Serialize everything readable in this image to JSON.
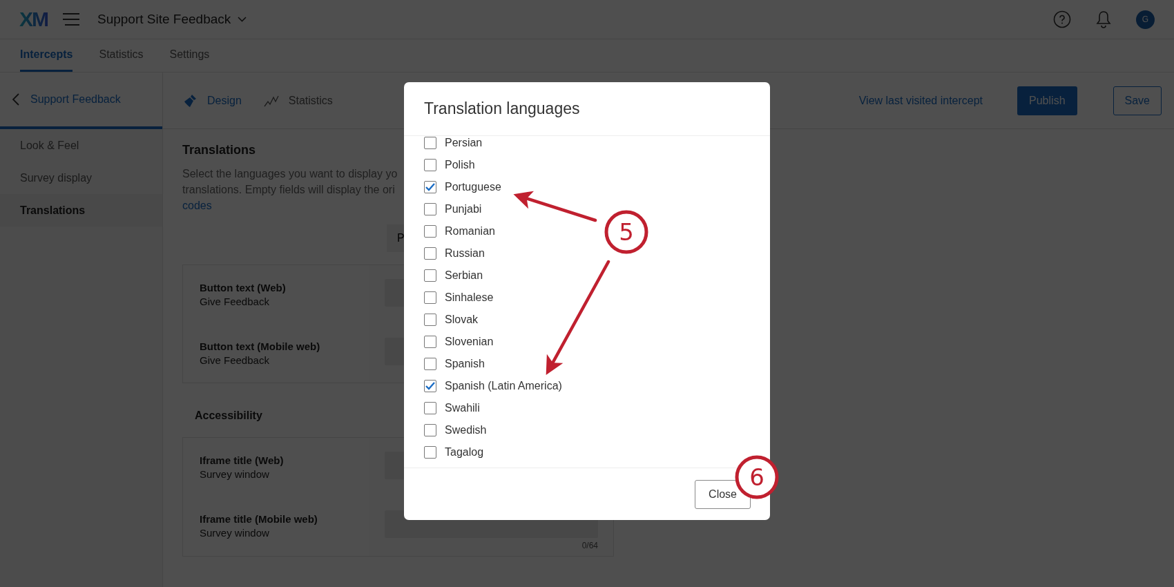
{
  "header": {
    "logo": "XM",
    "project_title": "Support Site Feedback",
    "avatar": "G"
  },
  "nav_tabs": [
    {
      "label": "Intercepts",
      "selected": true
    },
    {
      "label": "Statistics",
      "selected": false
    },
    {
      "label": "Settings",
      "selected": false
    }
  ],
  "sidebar": {
    "back_label": "Support Feedback",
    "items": [
      {
        "label": "Look & Feel",
        "selected": false
      },
      {
        "label": "Survey display",
        "selected": false
      },
      {
        "label": "Translations",
        "selected": true
      }
    ]
  },
  "sub_tabs": [
    {
      "label": "Design",
      "kind": "design",
      "selected": true
    },
    {
      "label": "Statistics",
      "kind": "statistics",
      "selected": false
    }
  ],
  "toolbar": {
    "link": "View last visited intercept",
    "publish": "Publish",
    "save": "Save"
  },
  "content": {
    "title": "Translations",
    "description_lines": [
      "Select the languages you want to display yo",
      "translations. Empty fields will display the ori"
    ],
    "link": "codes",
    "language_button": "P",
    "sections": [
      {
        "fields": [
          {
            "label": "Button text (Web)",
            "value": "Give Feedback"
          },
          {
            "label": "Button text (Mobile web)",
            "value": "Give Feedback"
          }
        ]
      },
      {
        "heading": "Accessibility",
        "fields": [
          {
            "label": "Iframe title (Web)",
            "value": "Survey window"
          },
          {
            "label": "Iframe title (Mobile web)",
            "value": "Survey window",
            "counter": "0/64"
          }
        ]
      }
    ]
  },
  "modal": {
    "title": "Translation languages",
    "languages": [
      {
        "label": "Persian",
        "checked": false
      },
      {
        "label": "Polish",
        "checked": false
      },
      {
        "label": "Portuguese",
        "checked": true
      },
      {
        "label": "Punjabi",
        "checked": false
      },
      {
        "label": "Romanian",
        "checked": false
      },
      {
        "label": "Russian",
        "checked": false
      },
      {
        "label": "Serbian",
        "checked": false
      },
      {
        "label": "Sinhalese",
        "checked": false
      },
      {
        "label": "Slovak",
        "checked": false
      },
      {
        "label": "Slovenian",
        "checked": false
      },
      {
        "label": "Spanish",
        "checked": false
      },
      {
        "label": "Spanish (Latin America)",
        "checked": true
      },
      {
        "label": "Swahili",
        "checked": false
      },
      {
        "label": "Swedish",
        "checked": false
      },
      {
        "label": "Tagalog",
        "checked": false
      }
    ],
    "close": "Close"
  },
  "annotations": [
    {
      "label": "5"
    },
    {
      "label": "6"
    }
  ]
}
